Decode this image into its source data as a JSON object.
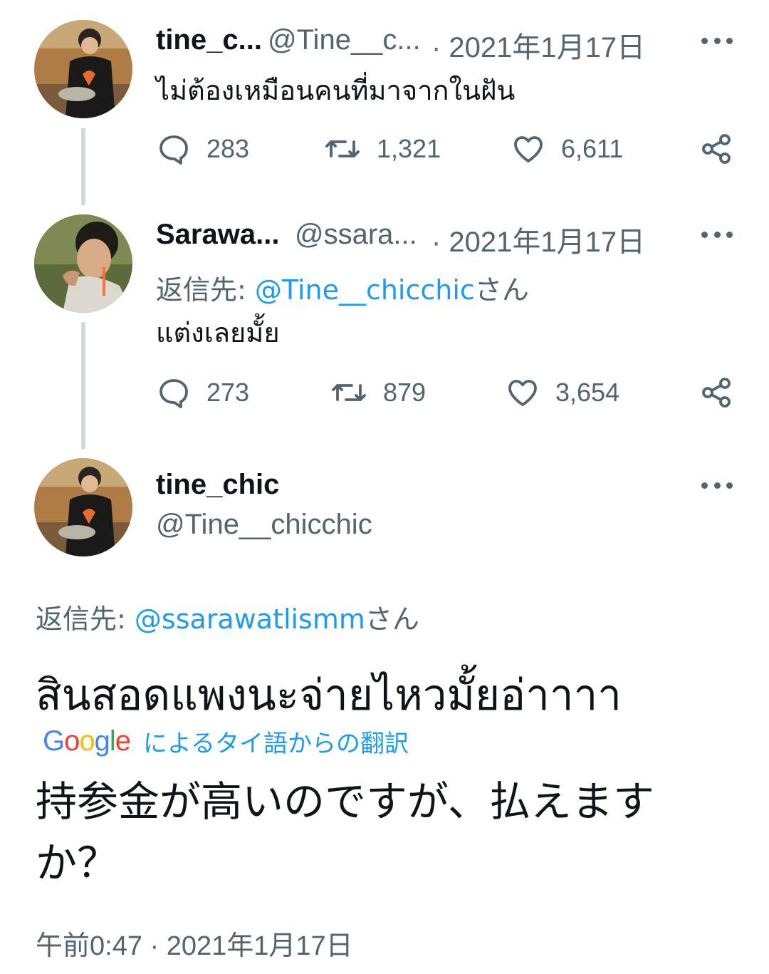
{
  "tweet1": {
    "name": "tine_c...",
    "handle": "@Tine__c...",
    "date": "· 2021年1月17日",
    "text": "ไม่ต้องเหมือนคนที่มาจากในฝัน",
    "replies": "283",
    "retweets": "1,321",
    "likes": "6,611"
  },
  "tweet2": {
    "name": "Sarawa...",
    "handle": "@ssara...",
    "date": "· 2021年1月17日",
    "reply_prefix": "返信先: ",
    "reply_to": "@Tine__chicchic",
    "reply_suffix": "さん",
    "text": "แต่งเลยมั้ย",
    "replies": "273",
    "retweets": "879",
    "likes": "3,654"
  },
  "main_tweet": {
    "name": "tine_chic",
    "handle": "@Tine__chicchic",
    "reply_prefix": "返信先: ",
    "reply_to": "@ssarawatlismm",
    "reply_suffix": "さん",
    "text": "สินสอดแพงนะจ่ายไหวมั้ยอ่าาาา",
    "translation_label": "によるタイ語からの翻訳",
    "translation_text": "持参金が高いのですが、払えますか？",
    "timestamp": "午前0:47 · 2021年1月17日"
  },
  "icons": {
    "reply": "reply-icon",
    "retweet": "retweet-icon",
    "like": "heart-icon",
    "share": "share-icon",
    "more": "more-icon"
  },
  "colors": {
    "link": "#1d9bf0",
    "secondary_text": "#536471",
    "thread_line": "#cfd9de"
  }
}
